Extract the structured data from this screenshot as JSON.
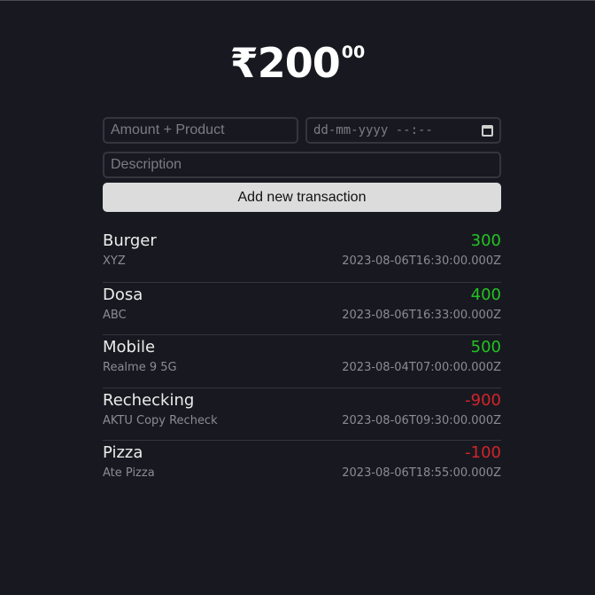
{
  "balance": {
    "symbol": "₹",
    "amount": "200",
    "cents": "00"
  },
  "form": {
    "amount_product_placeholder": "Amount + Product",
    "date_placeholder": "dd-mm-yyyy --:--",
    "description_placeholder": "Description",
    "add_button_label": "Add new transaction"
  },
  "transactions": [
    {
      "name": "Burger",
      "description": "XYZ",
      "amount": "300",
      "date": "2023-08-06T16:30:00.000Z",
      "type": "positive"
    },
    {
      "name": "Dosa",
      "description": "ABC",
      "amount": "400",
      "date": "2023-08-06T16:33:00.000Z",
      "type": "positive"
    },
    {
      "name": "Mobile",
      "description": "Realme 9 5G",
      "amount": "500",
      "date": "2023-08-04T07:00:00.000Z",
      "type": "positive"
    },
    {
      "name": "Rechecking",
      "description": "AKTU Copy Recheck",
      "amount": "-900",
      "date": "2023-08-06T09:30:00.000Z",
      "type": "negative"
    },
    {
      "name": "Pizza",
      "description": "Ate Pizza",
      "amount": "-100",
      "date": "2023-08-06T18:55:00.000Z",
      "type": "negative"
    }
  ],
  "colors": {
    "positive": "#22c322",
    "negative": "#d3232b",
    "background": "#181920"
  }
}
